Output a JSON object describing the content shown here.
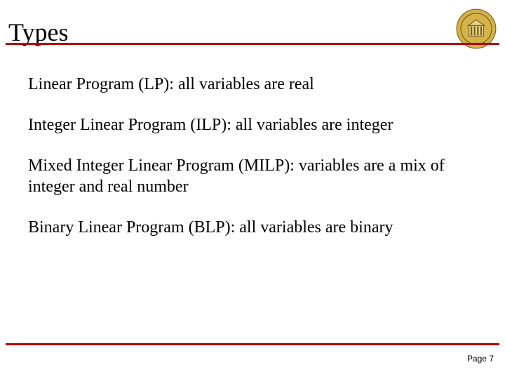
{
  "title": "Types",
  "bullets": [
    "Linear Program (LP): all variables are real",
    "Integer Linear Program (ILP): all variables are integer",
    "Mixed Integer Linear Program (MILP): variables are a mix of integer and real number",
    "Binary Linear Program (BLP): all variables are binary"
  ],
  "page_label": "Page 7",
  "colors": {
    "rule": "#b00000"
  }
}
